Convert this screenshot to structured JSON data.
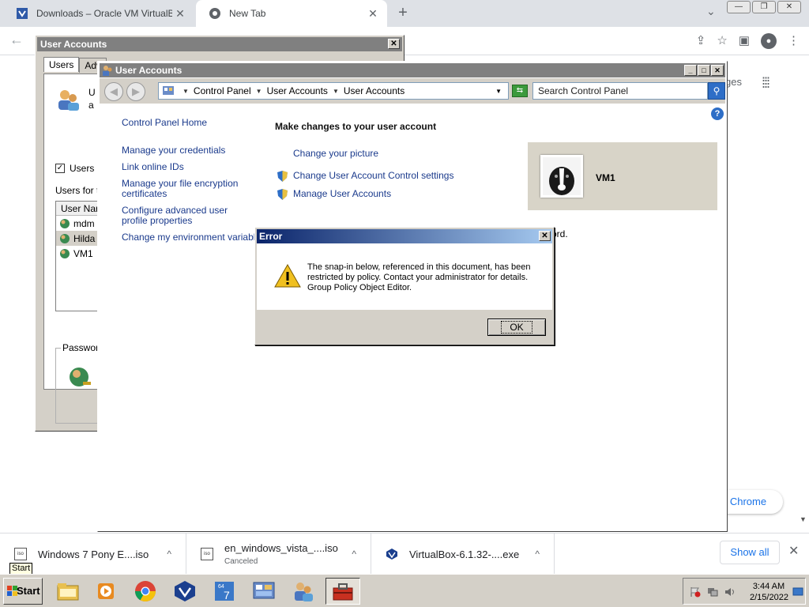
{
  "chrome": {
    "tabs": [
      {
        "title": "Downloads – Oracle VM VirtualB",
        "close": "✕"
      },
      {
        "title": "New Tab",
        "close": "✕"
      }
    ],
    "new_tab": "+",
    "tab_menu": "⌄",
    "back": "←",
    "window_buttons": [
      "—",
      "❐",
      "✕"
    ],
    "page_fragment_text": "ges",
    "pill_text": "e Chrome",
    "scroll_arrow": "▼"
  },
  "downloads": {
    "items": [
      {
        "name": "Windows 7 Pony E....iso",
        "status": "",
        "icon": "iso-file-icon"
      },
      {
        "name": "en_windows_vista_....iso",
        "status": "Canceled",
        "icon": "iso-file-icon"
      },
      {
        "name": "VirtualBox-6.1.32-....exe",
        "status": "",
        "icon": "virtualbox-icon"
      }
    ],
    "chevron": "^",
    "show_all": "Show all",
    "close": "✕"
  },
  "ua_dialog": {
    "title": "User Accounts",
    "close": "✕",
    "tabs": [
      "Users",
      "Adv"
    ],
    "intro_fragment": "U",
    "intro_fragment2": "a",
    "checkbox_label": "Users r",
    "checkbox_mark": "✓",
    "users_for_label": "Users for t",
    "list_header": "User Nar",
    "users": [
      "mdm",
      "Hilda",
      "VM1"
    ],
    "password_group": "Passwor"
  },
  "cp": {
    "title": "User Accounts",
    "buttons": [
      "_",
      "□",
      "✕"
    ],
    "breadcrumb": [
      "Control Panel",
      "User Accounts",
      "User Accounts"
    ],
    "search_placeholder": "Search Control Panel",
    "help": "?",
    "sidebar_links": [
      "Control Panel Home",
      "Manage your credentials",
      "Link online IDs",
      "Manage your file encryption certificates",
      "Configure advanced user profile properties",
      "Change my environment variables"
    ],
    "heading": "Make changes to your user account",
    "tasks": [
      "Change your picture",
      "Change User Account Control settings",
      "Manage User Accounts"
    ],
    "account_name": "VM1",
    "fragment": "ord."
  },
  "error": {
    "title": "Error",
    "close": "✕",
    "message": "The snap-in below, referenced in this document, has been restricted by policy. Contact your administrator for details.",
    "message_line3": "Group Policy Object Editor.",
    "ok": "OK"
  },
  "taskbar": {
    "start_label": "Start",
    "tooltip": "Start",
    "apps": [
      "explorer-icon",
      "media-player-icon",
      "chrome-icon",
      "virtualbox-icon",
      "win7-64-icon",
      "control-panel-icon",
      "user-accounts-icon",
      "toolbox-icon"
    ],
    "time": "3:44 AM",
    "date": "2/15/2022"
  }
}
